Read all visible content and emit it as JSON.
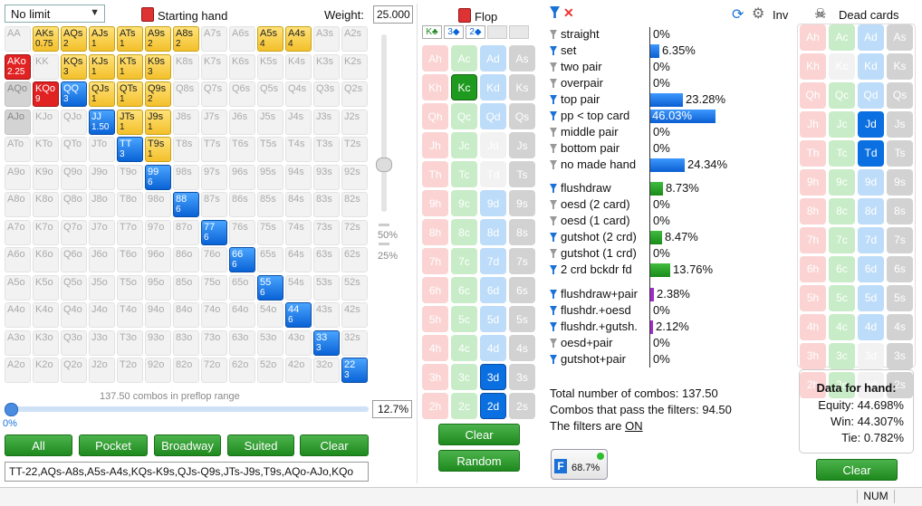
{
  "range_panel": {
    "limit_select": "No limit",
    "starting_hand_label": "Starting hand",
    "weight_label": "Weight:",
    "weight_value": "25.000",
    "slider_marks": [
      "50%",
      "25%"
    ],
    "combos_text": "137.50 combos in preflop range",
    "percent_left": "0%",
    "percent_value": "12.7%",
    "buttons": [
      "All",
      "Pocket",
      "Broadway",
      "Suited",
      "Clear"
    ],
    "range_string": "TT-22,AQs-A8s,A5s-A4s,KQs-K9s,QJs-Q9s,JTs-J9s,T9s,AQo-AJo,KQo"
  },
  "hand_grid": [
    [
      [
        "AA",
        "",
        ""
      ],
      [
        "AKs",
        "0.75",
        "y"
      ],
      [
        "AQs",
        "2",
        "y"
      ],
      [
        "AJs",
        "1",
        "y"
      ],
      [
        "ATs",
        "1",
        "y"
      ],
      [
        "A9s",
        "2",
        "y"
      ],
      [
        "A8s",
        "2",
        "y"
      ],
      [
        "A7s",
        "",
        ""
      ],
      [
        "A6s",
        "",
        ""
      ],
      [
        "A5s",
        "4",
        "y"
      ],
      [
        "A4s",
        "4",
        "y"
      ],
      [
        "A3s",
        "",
        ""
      ],
      [
        "A2s",
        "",
        ""
      ]
    ],
    [
      [
        "AKo",
        "2.25",
        "r"
      ],
      [
        "KK",
        "",
        ""
      ],
      [
        "KQs",
        "3",
        "y"
      ],
      [
        "KJs",
        "1",
        "y"
      ],
      [
        "KTs",
        "1",
        "y"
      ],
      [
        "K9s",
        "3",
        "y"
      ],
      [
        "K8s",
        "",
        ""
      ],
      [
        "K7s",
        "",
        ""
      ],
      [
        "K6s",
        "",
        ""
      ],
      [
        "K5s",
        "",
        ""
      ],
      [
        "K4s",
        "",
        ""
      ],
      [
        "K3s",
        "",
        ""
      ],
      [
        "K2s",
        "",
        ""
      ]
    ],
    [
      [
        "AQo",
        "",
        "g"
      ],
      [
        "KQo",
        "9",
        "r"
      ],
      [
        "QQ",
        "3",
        "b"
      ],
      [
        "QJs",
        "1",
        "y"
      ],
      [
        "QTs",
        "1",
        "y"
      ],
      [
        "Q9s",
        "2",
        "y"
      ],
      [
        "Q8s",
        "",
        ""
      ],
      [
        "Q7s",
        "",
        ""
      ],
      [
        "Q6s",
        "",
        ""
      ],
      [
        "Q5s",
        "",
        ""
      ],
      [
        "Q4s",
        "",
        ""
      ],
      [
        "Q3s",
        "",
        ""
      ],
      [
        "Q2s",
        "",
        ""
      ]
    ],
    [
      [
        "AJo",
        "",
        "g"
      ],
      [
        "KJo",
        "",
        ""
      ],
      [
        "QJo",
        "",
        ""
      ],
      [
        "JJ",
        "1.50",
        "b"
      ],
      [
        "JTs",
        "1",
        "y"
      ],
      [
        "J9s",
        "1",
        "y"
      ],
      [
        "J8s",
        "",
        ""
      ],
      [
        "J7s",
        "",
        ""
      ],
      [
        "J6s",
        "",
        ""
      ],
      [
        "J5s",
        "",
        ""
      ],
      [
        "J4s",
        "",
        ""
      ],
      [
        "J3s",
        "",
        ""
      ],
      [
        "J2s",
        "",
        ""
      ]
    ],
    [
      [
        "ATo",
        "",
        ""
      ],
      [
        "KTo",
        "",
        ""
      ],
      [
        "QTo",
        "",
        ""
      ],
      [
        "JTo",
        "",
        ""
      ],
      [
        "TT",
        "3",
        "b"
      ],
      [
        "T9s",
        "1",
        "y"
      ],
      [
        "T8s",
        "",
        ""
      ],
      [
        "T7s",
        "",
        ""
      ],
      [
        "T6s",
        "",
        ""
      ],
      [
        "T5s",
        "",
        ""
      ],
      [
        "T4s",
        "",
        ""
      ],
      [
        "T3s",
        "",
        ""
      ],
      [
        "T2s",
        "",
        ""
      ]
    ],
    [
      [
        "A9o",
        "",
        ""
      ],
      [
        "K9o",
        "",
        ""
      ],
      [
        "Q9o",
        "",
        ""
      ],
      [
        "J9o",
        "",
        ""
      ],
      [
        "T9o",
        "",
        ""
      ],
      [
        "99",
        "6",
        "b"
      ],
      [
        "98s",
        "",
        ""
      ],
      [
        "97s",
        "",
        ""
      ],
      [
        "96s",
        "",
        ""
      ],
      [
        "95s",
        "",
        ""
      ],
      [
        "94s",
        "",
        ""
      ],
      [
        "93s",
        "",
        ""
      ],
      [
        "92s",
        "",
        ""
      ]
    ],
    [
      [
        "A8o",
        "",
        ""
      ],
      [
        "K8o",
        "",
        ""
      ],
      [
        "Q8o",
        "",
        ""
      ],
      [
        "J8o",
        "",
        ""
      ],
      [
        "T8o",
        "",
        ""
      ],
      [
        "98o",
        "",
        ""
      ],
      [
        "88",
        "6",
        "b"
      ],
      [
        "87s",
        "",
        ""
      ],
      [
        "86s",
        "",
        ""
      ],
      [
        "85s",
        "",
        ""
      ],
      [
        "84s",
        "",
        ""
      ],
      [
        "83s",
        "",
        ""
      ],
      [
        "82s",
        "",
        ""
      ]
    ],
    [
      [
        "A7o",
        "",
        ""
      ],
      [
        "K7o",
        "",
        ""
      ],
      [
        "Q7o",
        "",
        ""
      ],
      [
        "J7o",
        "",
        ""
      ],
      [
        "T7o",
        "",
        ""
      ],
      [
        "97o",
        "",
        ""
      ],
      [
        "87o",
        "",
        ""
      ],
      [
        "77",
        "6",
        "b"
      ],
      [
        "76s",
        "",
        ""
      ],
      [
        "75s",
        "",
        ""
      ],
      [
        "74s",
        "",
        ""
      ],
      [
        "73s",
        "",
        ""
      ],
      [
        "72s",
        "",
        ""
      ]
    ],
    [
      [
        "A6o",
        "",
        ""
      ],
      [
        "K6o",
        "",
        ""
      ],
      [
        "Q6o",
        "",
        ""
      ],
      [
        "J6o",
        "",
        ""
      ],
      [
        "T6o",
        "",
        ""
      ],
      [
        "96o",
        "",
        ""
      ],
      [
        "86o",
        "",
        ""
      ],
      [
        "76o",
        "",
        ""
      ],
      [
        "66",
        "6",
        "b"
      ],
      [
        "65s",
        "",
        ""
      ],
      [
        "64s",
        "",
        ""
      ],
      [
        "63s",
        "",
        ""
      ],
      [
        "62s",
        "",
        ""
      ]
    ],
    [
      [
        "A5o",
        "",
        ""
      ],
      [
        "K5o",
        "",
        ""
      ],
      [
        "Q5o",
        "",
        ""
      ],
      [
        "J5o",
        "",
        ""
      ],
      [
        "T5o",
        "",
        ""
      ],
      [
        "95o",
        "",
        ""
      ],
      [
        "85o",
        "",
        ""
      ],
      [
        "75o",
        "",
        ""
      ],
      [
        "65o",
        "",
        ""
      ],
      [
        "55",
        "6",
        "b"
      ],
      [
        "54s",
        "",
        ""
      ],
      [
        "53s",
        "",
        ""
      ],
      [
        "52s",
        "",
        ""
      ]
    ],
    [
      [
        "A4o",
        "",
        ""
      ],
      [
        "K4o",
        "",
        ""
      ],
      [
        "Q4o",
        "",
        ""
      ],
      [
        "J4o",
        "",
        ""
      ],
      [
        "T4o",
        "",
        ""
      ],
      [
        "94o",
        "",
        ""
      ],
      [
        "84o",
        "",
        ""
      ],
      [
        "74o",
        "",
        ""
      ],
      [
        "64o",
        "",
        ""
      ],
      [
        "54o",
        "",
        ""
      ],
      [
        "44",
        "6",
        "b"
      ],
      [
        "43s",
        "",
        ""
      ],
      [
        "42s",
        "",
        ""
      ]
    ],
    [
      [
        "A3o",
        "",
        ""
      ],
      [
        "K3o",
        "",
        ""
      ],
      [
        "Q3o",
        "",
        ""
      ],
      [
        "J3o",
        "",
        ""
      ],
      [
        "T3o",
        "",
        ""
      ],
      [
        "93o",
        "",
        ""
      ],
      [
        "83o",
        "",
        ""
      ],
      [
        "73o",
        "",
        ""
      ],
      [
        "63o",
        "",
        ""
      ],
      [
        "53o",
        "",
        ""
      ],
      [
        "43o",
        "",
        ""
      ],
      [
        "33",
        "3",
        "b"
      ],
      [
        "32s",
        "",
        ""
      ]
    ],
    [
      [
        "A2o",
        "",
        ""
      ],
      [
        "K2o",
        "",
        ""
      ],
      [
        "Q2o",
        "",
        ""
      ],
      [
        "J2o",
        "",
        ""
      ],
      [
        "T2o",
        "",
        ""
      ],
      [
        "92o",
        "",
        ""
      ],
      [
        "82o",
        "",
        ""
      ],
      [
        "72o",
        "",
        ""
      ],
      [
        "62o",
        "",
        ""
      ],
      [
        "52o",
        "",
        ""
      ],
      [
        "42o",
        "",
        ""
      ],
      [
        "32o",
        "",
        ""
      ],
      [
        "22",
        "3",
        "b"
      ]
    ]
  ],
  "flop_panel": {
    "title": "Flop",
    "board": [
      "K♣",
      "3◆",
      "2◆",
      "",
      ""
    ],
    "clear_label": "Clear",
    "random_label": "Random"
  },
  "card_ranks": [
    "A",
    "K",
    "Q",
    "J",
    "T",
    "9",
    "8",
    "7",
    "6",
    "5",
    "4",
    "3",
    "2"
  ],
  "card_suits": [
    "h",
    "c",
    "d",
    "s"
  ],
  "flop_selected": {
    "Kc": "c",
    "3d": "d",
    "2d": "d"
  },
  "flop_used": [
    "Jd",
    "Td"
  ],
  "dead_selected": {
    "Jd": "d",
    "Td": "d"
  },
  "dead_used": [
    "Kc",
    "3d",
    "2d"
  ],
  "filters": {
    "inv_label": "Inv",
    "made": [
      {
        "name": "straight",
        "pct": "0%",
        "value": 0,
        "on": false
      },
      {
        "name": "set",
        "pct": "6.35%",
        "value": 6.35,
        "on": true
      },
      {
        "name": "two pair",
        "pct": "0%",
        "value": 0,
        "on": false
      },
      {
        "name": "overpair",
        "pct": "0%",
        "value": 0,
        "on": false
      },
      {
        "name": "top pair",
        "pct": "23.28%",
        "value": 23.28,
        "on": true
      },
      {
        "name": "pp < top card",
        "pct": "46.03%",
        "value": 46.03,
        "on": true,
        "highlight": true
      },
      {
        "name": "middle pair",
        "pct": "0%",
        "value": 0,
        "on": false
      },
      {
        "name": "bottom pair",
        "pct": "0%",
        "value": 0,
        "on": false
      },
      {
        "name": "no made hand",
        "pct": "24.34%",
        "value": 24.34,
        "on": false
      }
    ],
    "draws": [
      {
        "name": "flushdraw",
        "pct": "8.73%",
        "value": 8.73,
        "on": true
      },
      {
        "name": "oesd (2 card)",
        "pct": "0%",
        "value": 0,
        "on": false
      },
      {
        "name": "oesd (1 card)",
        "pct": "0%",
        "value": 0,
        "on": false
      },
      {
        "name": "gutshot (2 crd)",
        "pct": "8.47%",
        "value": 8.47,
        "on": true
      },
      {
        "name": "gutshot (1 crd)",
        "pct": "0%",
        "value": 0,
        "on": false
      },
      {
        "name": "2 crd bckdr fd",
        "pct": "13.76%",
        "value": 13.76,
        "on": true
      }
    ],
    "combos": [
      {
        "name": "flushdraw+pair",
        "pct": "2.38%",
        "value": 2.38,
        "on": true
      },
      {
        "name": "flushdr.+oesd",
        "pct": "0%",
        "value": 0,
        "on": true
      },
      {
        "name": "flushdr.+gutsh.",
        "pct": "2.12%",
        "value": 2.12,
        "on": true
      },
      {
        "name": "oesd+pair",
        "pct": "0%",
        "value": 0,
        "on": false
      },
      {
        "name": "gutshot+pair",
        "pct": "0%",
        "value": 0,
        "on": true
      }
    ],
    "total_combos": "Total number of combos: 137.50",
    "pass_combos": "Combos that pass the filters: 94.50",
    "filters_on_prefix": "The filters are ",
    "filters_on_state": "ON",
    "filter_badge_pct": "68.7%",
    "filter_badge_letter": "F"
  },
  "dead_panel": {
    "title": "Dead cards",
    "data_title": "Data for hand:",
    "equity_label": "Equity:",
    "equity": "44.698%",
    "win_label": "Win:",
    "win": "44.307%",
    "tie_label": "Tie:",
    "tie": "0.782%",
    "clear_label": "Clear"
  },
  "status": {
    "num": "NUM"
  },
  "colors": {
    "accent_blue": "#0a63d6",
    "suited_yellow": "#f3c02b",
    "green_button": "#1e8a1e",
    "red_offsuit": "#e02222"
  }
}
